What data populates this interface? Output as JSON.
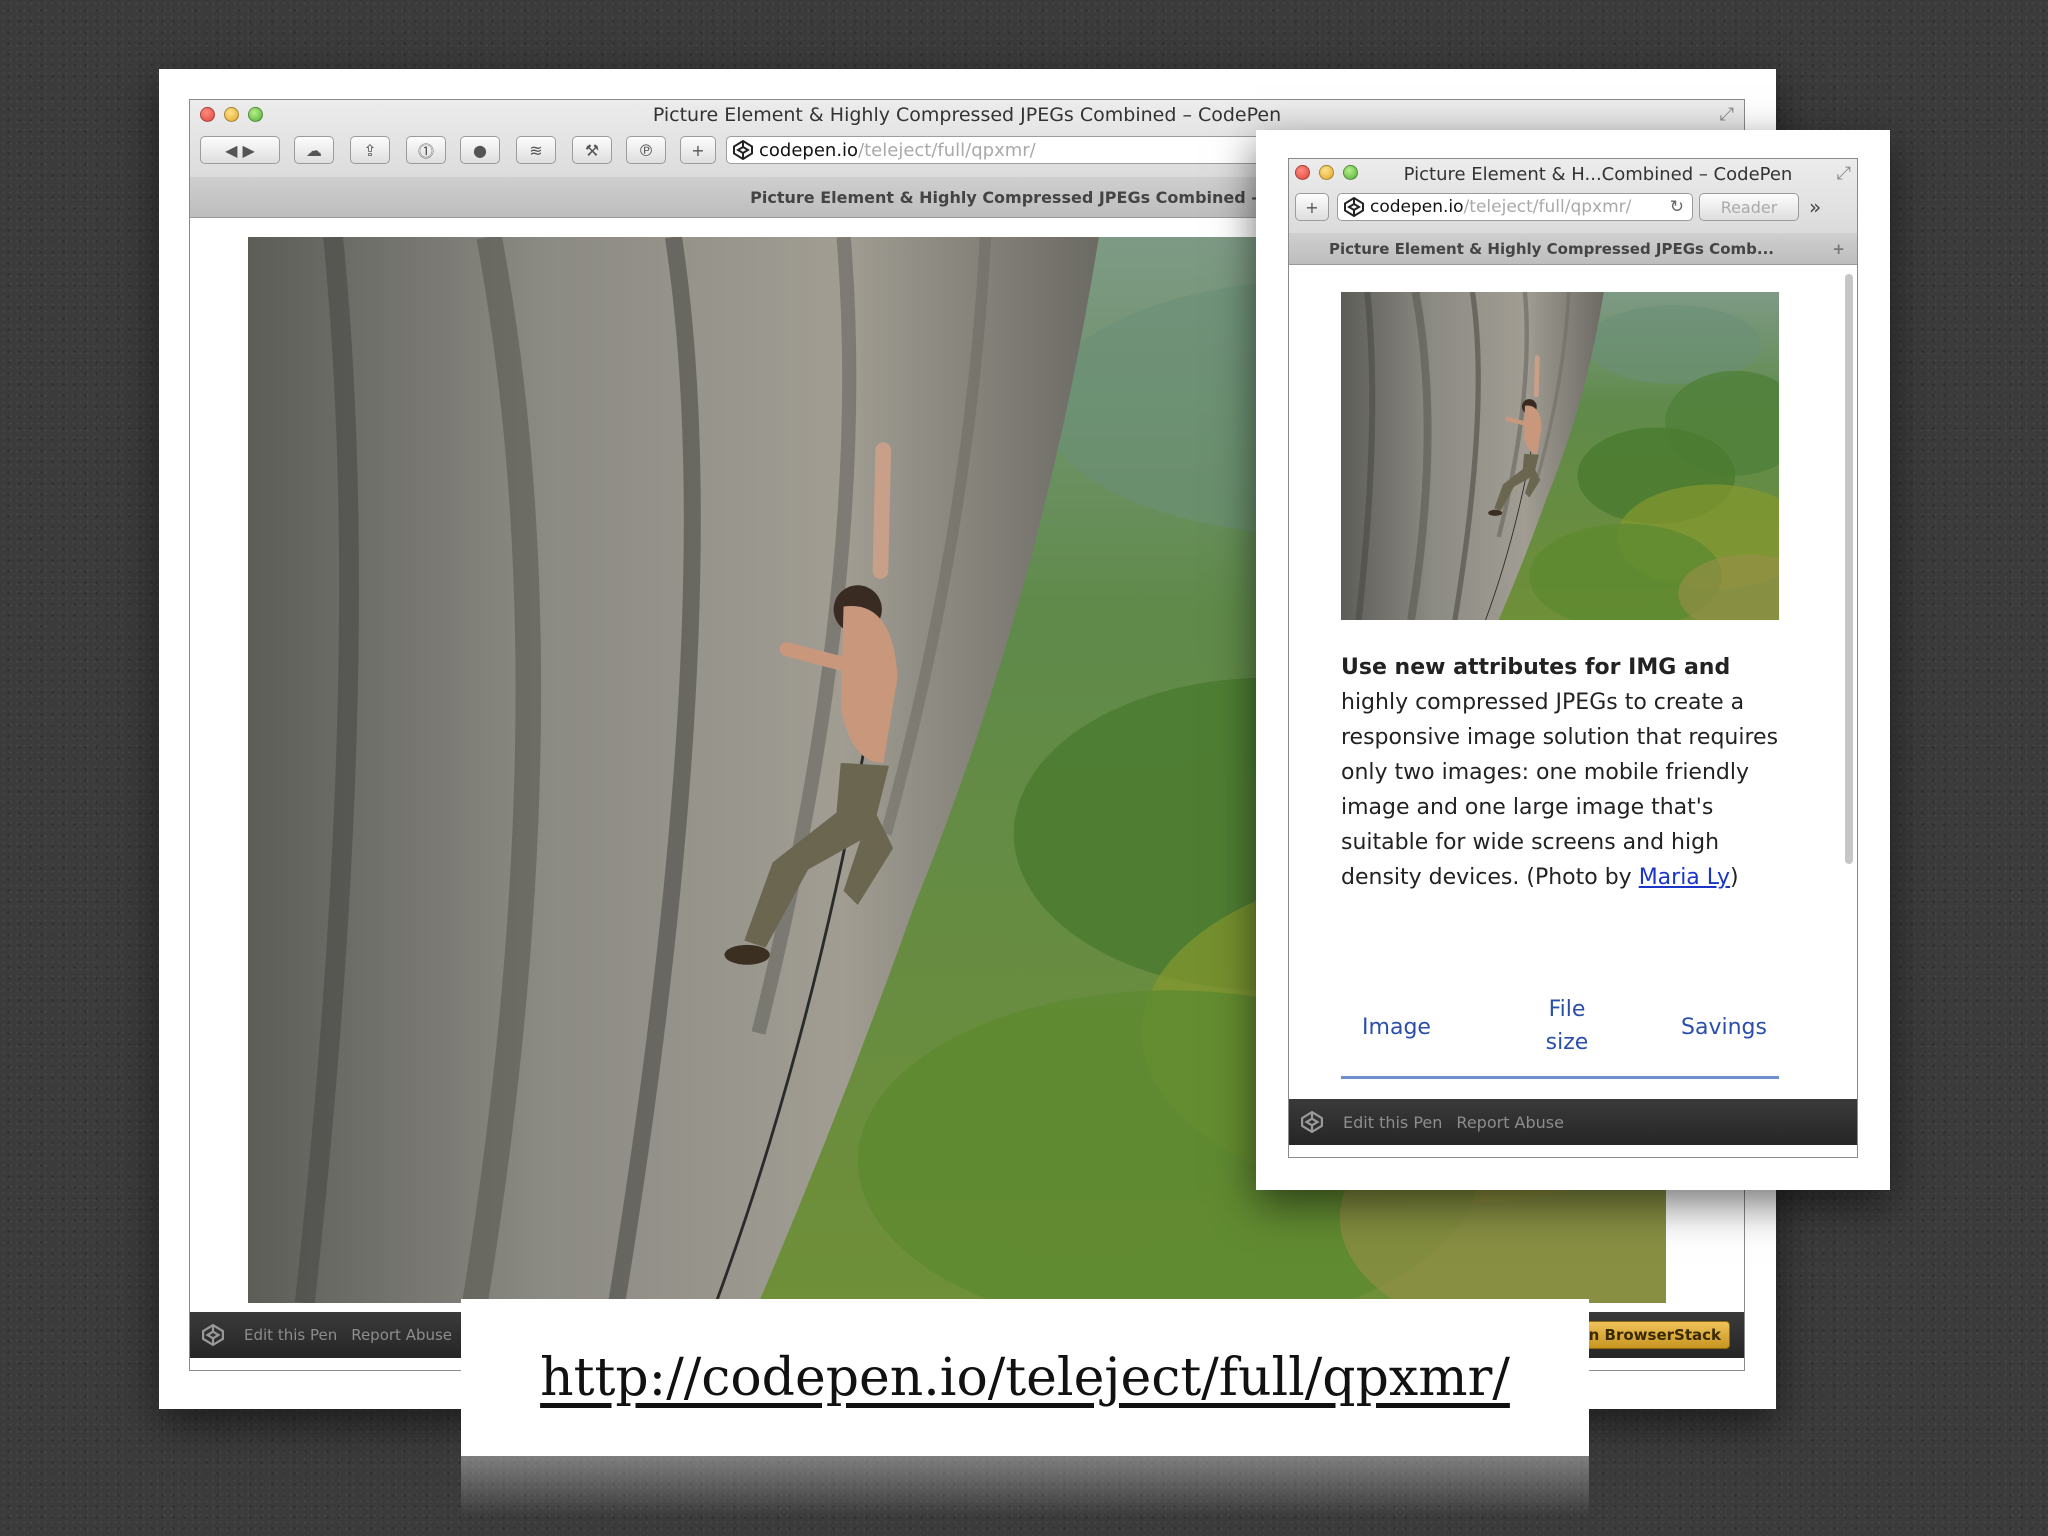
{
  "main_window": {
    "title": "Picture Element & Highly Compressed JPEGs Combined – CodePen",
    "url_host": "codepen.io",
    "url_path": "/teleject/full/qpxmr/",
    "tab_title": "Picture Element & Highly Compressed JPEGs Combined – CodePen",
    "footer": {
      "edit": "Edit this Pen",
      "report": "Report Abuse",
      "browserstack": "Test in BrowserStack"
    }
  },
  "small_window": {
    "title": "Picture Element & H...Combined – CodePen",
    "url_host": "codepen.io",
    "url_path": "/teleject/full/qpxmr/",
    "reader": "Reader",
    "tab_title": "Picture Element & Highly Compressed JPEGs Comb...",
    "desc_bold": "Use new attributes for IMG and",
    "desc_text": "highly compressed JPEGs to create a responsive image solution that requires only two images: one mobile friendly image and one large image that's suitable for wide screens and high density devices. (Photo by ",
    "desc_link": "Maria Ly",
    "desc_end": ")",
    "table_headers": [
      "Image",
      "File size",
      "Savings"
    ],
    "footer": {
      "edit": "Edit this Pen",
      "report": "Report Abuse"
    }
  },
  "caption": {
    "url": "http://codepen.io/teleject/full/qpxmr/"
  },
  "colors": {
    "link": "#1a35c8",
    "table_header": "#2b4fa8",
    "background": "#3b3b3b"
  }
}
